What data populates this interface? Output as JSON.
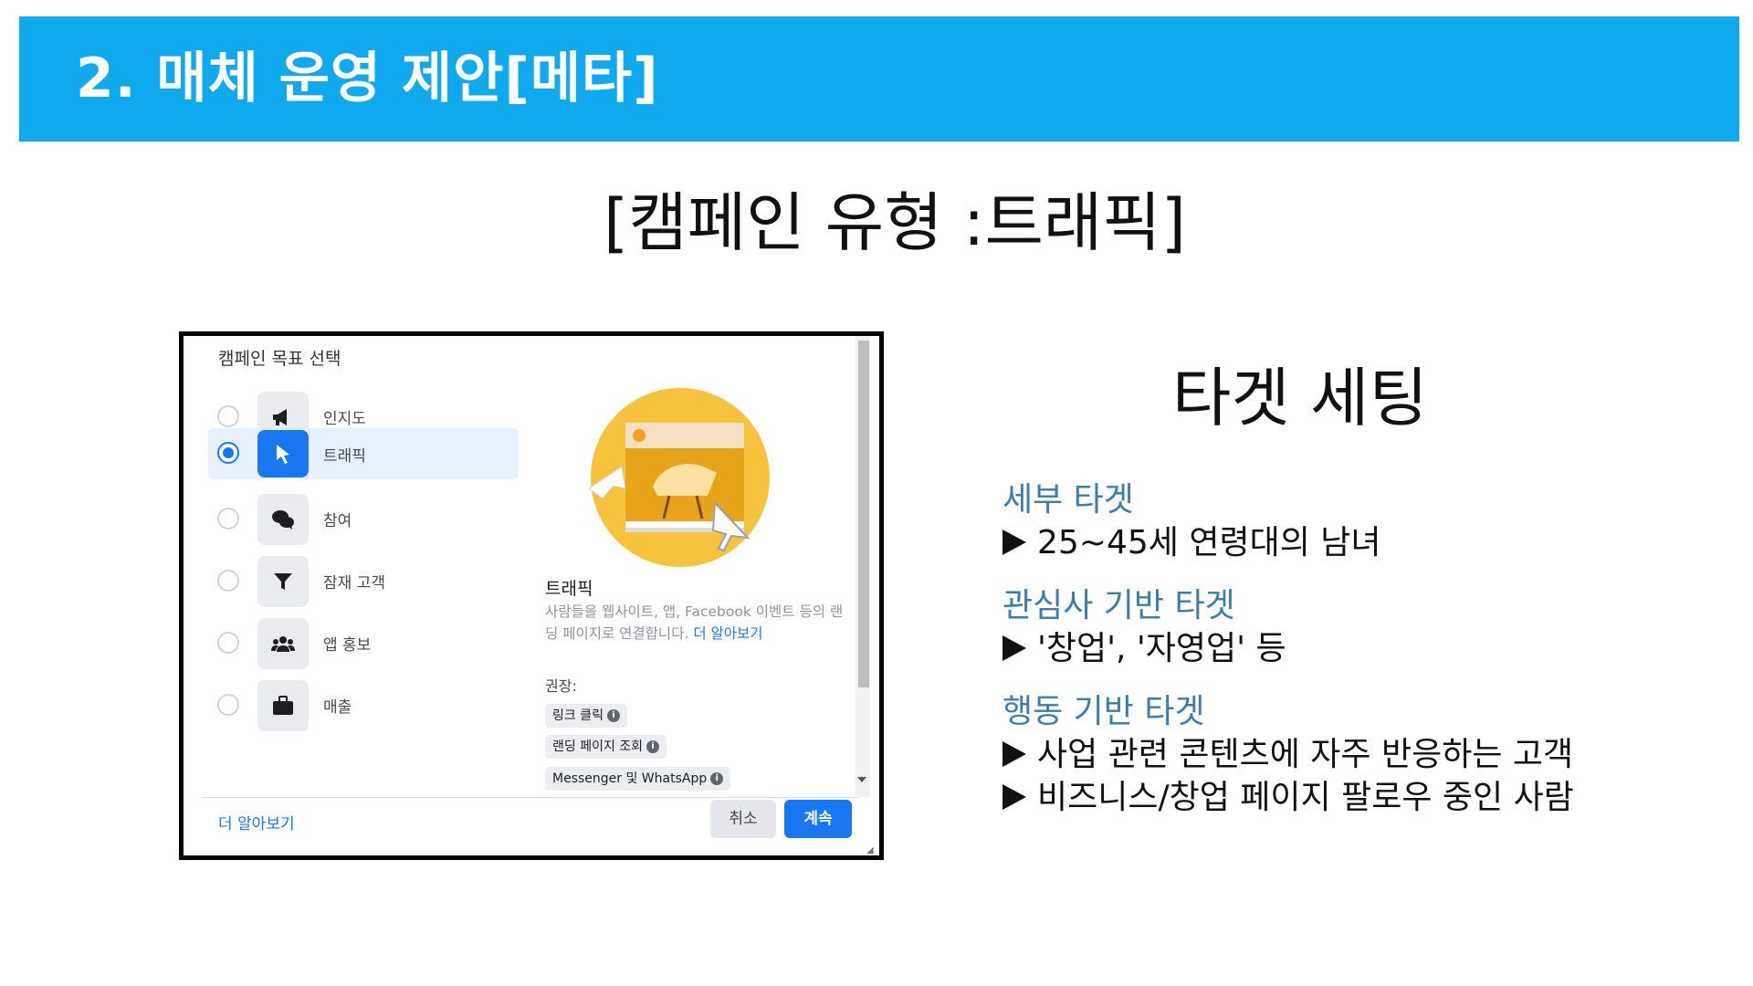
{
  "header": {
    "title": "2. 매체 운영 제안[메타]",
    "bar_color": "#0fa9ee"
  },
  "slide": {
    "subtitle": "[캠페인 유형 :트래픽]"
  },
  "campaign_dialog": {
    "title": "캠페인 목표 선택",
    "objectives": [
      {
        "label": "인지도",
        "icon": "megaphone-icon",
        "selected": false
      },
      {
        "label": "트래픽",
        "icon": "cursor-icon",
        "selected": true
      },
      {
        "label": "참여",
        "icon": "chat-bubbles-icon",
        "selected": false
      },
      {
        "label": "잠재 고객",
        "icon": "funnel-icon",
        "selected": false
      },
      {
        "label": "앱 홍보",
        "icon": "people-icon",
        "selected": false
      },
      {
        "label": "매출",
        "icon": "briefcase-icon",
        "selected": false
      }
    ],
    "detail": {
      "title": "트래픽",
      "description": "사람들을 웹사이트, 앱, Facebook 이벤트 등의 랜딩 페이지로 연결합니다.",
      "link": "더 알아보기",
      "recommend_label": "권장:",
      "chips": [
        "링크 클릭",
        "랜딩 페이지 조회",
        "Messenger 및 WhatsApp"
      ]
    },
    "footer": {
      "learn_more": "더 알아보기",
      "cancel": "취소",
      "continue": "계속"
    },
    "accent_color": "#1877f2"
  },
  "targeting": {
    "heading": "타겟 세팅",
    "sections": [
      {
        "title": "세부 타겟",
        "lines": [
          "25~45세 연령대의  남녀"
        ]
      },
      {
        "title": "관심사 기반 타겟",
        "lines": [
          "'창업', '자영업' 등"
        ]
      },
      {
        "title": "행동 기반 타겟",
        "lines": [
          "사업 관련 콘텐츠에 자주 반응하는 고객",
          "비즈니스/창업 페이지 팔로우 중인 사람"
        ]
      }
    ],
    "title_color": "#3d7da8"
  }
}
